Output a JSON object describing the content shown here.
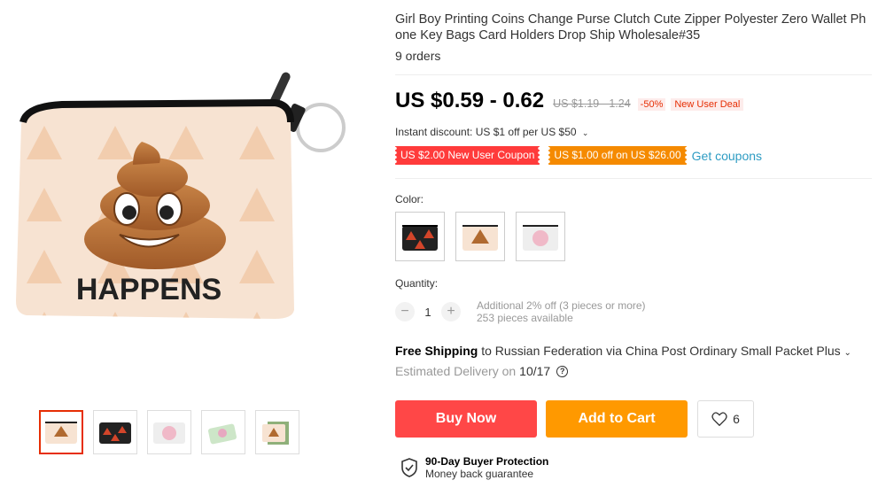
{
  "product": {
    "title": "Girl Boy Printing Coins Change Purse Clutch Cute Zipper Polyester Zero Wallet Phone Key Bags Card Holders Drop Ship Wholesale#35",
    "orders": "9 orders",
    "main_image_text": "HAPPENS",
    "price": "US $0.59 - 0.62",
    "old_price": "US $1.19 - 1.24",
    "discount": "-50%",
    "deal_badge": "New User Deal",
    "instant_discount": "Instant discount: US $1 off per US $50",
    "coupons": [
      "US $2.00 New User Coupon",
      "US $1.00 off on US $26.00"
    ],
    "get_coupons": "Get coupons",
    "color_label": "Color:",
    "quantity_label": "Quantity:",
    "quantity": "1",
    "qty_note1": "Additional 2% off (3 pieces or more)",
    "qty_note2": "253 pieces available",
    "shipping_free": "Free Shipping",
    "shipping_rest": "to Russian Federation via China Post Ordinary Small Packet Plus",
    "delivery_label": "Estimated Delivery on",
    "delivery_date": "10/17",
    "buy_now": "Buy Now",
    "add_to_cart": "Add to Cart",
    "wishlist_count": "6",
    "protection_title": "90-Day Buyer Protection",
    "protection_sub": "Money back guarantee"
  },
  "colors": {
    "accent_red": "#ff4747",
    "accent_orange": "#ff9900",
    "link_blue": "#2e9cc3"
  }
}
